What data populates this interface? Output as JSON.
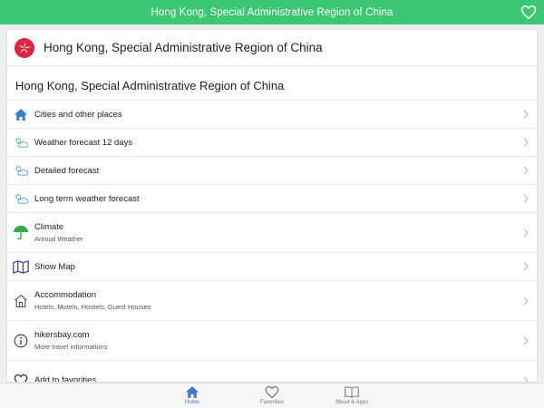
{
  "topbar": {
    "title": "Hong Kong, Special Administrative Region of China"
  },
  "header": {
    "title": "Hong Kong, Special Administrative Region of China"
  },
  "section": {
    "title": "Hong Kong, Special Administrative Region of China"
  },
  "menu": [
    {
      "label": "Cities and other places",
      "subtitle": "",
      "icon": "home-icon"
    },
    {
      "label": "Weather forecast 12 days",
      "subtitle": "",
      "icon": "weather-icon"
    },
    {
      "label": "Detailed forecast",
      "subtitle": "",
      "icon": "weather-icon"
    },
    {
      "label": "Long term weather forecast",
      "subtitle": "",
      "icon": "weather-icon"
    },
    {
      "label": "Climate",
      "subtitle": "Annual Weather",
      "icon": "umbrella-icon"
    },
    {
      "label": "Show Map",
      "subtitle": "",
      "icon": "map-icon"
    },
    {
      "label": "Accommodation",
      "subtitle": "Hotels, Motels, Hostels, Guest Houses",
      "icon": "house-outline-icon"
    },
    {
      "label": "hikersbay.com",
      "subtitle": "More travel informations",
      "icon": "info-icon"
    },
    {
      "label": "Add to favorities",
      "subtitle": "",
      "icon": "heart-icon"
    }
  ],
  "tabs": [
    {
      "label": "Home",
      "icon": "home-icon",
      "active": true
    },
    {
      "label": "Favorities",
      "icon": "heart-icon",
      "active": false
    },
    {
      "label": "About & Apps",
      "icon": "book-icon",
      "active": false
    }
  ],
  "colors": {
    "accent_green": "#3cc873",
    "flag_red": "#e0243a",
    "home_blue": "#3a7bd5",
    "umbrella_green": "#2fae4b",
    "map_purple": "#5a3fa8"
  }
}
